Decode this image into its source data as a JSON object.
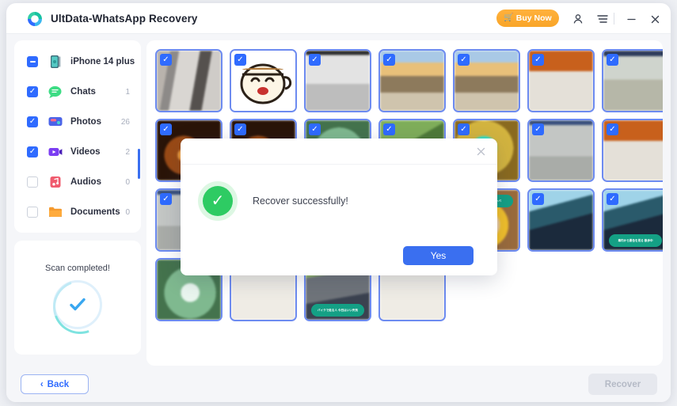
{
  "window": {
    "title": "UltData-WhatsApp Recovery",
    "logo_icon": "tenorshare-swirl-logo",
    "buy_now": {
      "label": "Buy Now",
      "icon": "cart-icon",
      "color": "#f9a528"
    },
    "account_icon": "person-icon",
    "menu_icon": "hamburger-menu-icon",
    "minimize_icon": "minimize-icon",
    "close_icon": "close-icon"
  },
  "sidebar": {
    "items": [
      {
        "label": "iPhone 14 plus",
        "count": "",
        "checkbox": "indeterminate",
        "icon": "phone-icon"
      },
      {
        "label": "Chats",
        "count": "1",
        "checkbox": "checked",
        "icon": "chat-bubble-icon"
      },
      {
        "label": "Photos",
        "count": "26",
        "checkbox": "checked",
        "icon": "photo-icon"
      },
      {
        "label": "Videos",
        "count": "2",
        "checkbox": "checked",
        "icon": "video-icon"
      },
      {
        "label": "Audios",
        "count": "0",
        "checkbox": "unchecked",
        "icon": "audio-note-icon"
      },
      {
        "label": "Documents",
        "count": "0",
        "checkbox": "unchecked",
        "icon": "folder-icon"
      }
    ],
    "scan": {
      "status": "Scan completed!",
      "icon": "check-circle-icon"
    }
  },
  "gallery": {
    "thumbnails": [
      {
        "selected": true,
        "kind": "fabric-gray",
        "badge": ""
      },
      {
        "selected": true,
        "kind": "coffee-emoji",
        "badge": ""
      },
      {
        "selected": true,
        "kind": "gray-gradient",
        "badge": ""
      },
      {
        "selected": true,
        "kind": "beach-dawn",
        "badge": ""
      },
      {
        "selected": true,
        "kind": "beach-dawn",
        "badge": ""
      },
      {
        "selected": true,
        "kind": "orange-table",
        "badge": ""
      },
      {
        "selected": true,
        "kind": "pale-interior",
        "badge": ""
      },
      {
        "selected": true,
        "kind": "candle-dark",
        "badge": ""
      },
      {
        "selected": true,
        "kind": "candle-dark",
        "badge": ""
      },
      {
        "selected": true,
        "kind": "green-blur",
        "badge": ""
      },
      {
        "selected": true,
        "kind": "green-leaf",
        "badge": ""
      },
      {
        "selected": true,
        "kind": "teal-glow",
        "badge": ""
      },
      {
        "selected": true,
        "kind": "mesh-gray",
        "badge": ""
      },
      {
        "selected": true,
        "kind": "orange-table",
        "badge": ""
      },
      {
        "selected": true,
        "kind": "mesh-gray",
        "badge": ""
      },
      {
        "selected": false,
        "kind": "candle-dark",
        "badge": ""
      },
      {
        "selected": false,
        "kind": "teal-glow",
        "badge": ""
      },
      {
        "selected": false,
        "kind": "street-scene",
        "badge": ""
      },
      {
        "selected": true,
        "kind": "latte-heart",
        "badge": "カフェで休憩中\nルンバ"
      },
      {
        "selected": true,
        "kind": "dashboard-teal",
        "badge": ""
      },
      {
        "selected": true,
        "kind": "dashboard-teal",
        "badge": "車内から景色を見る\n散歩中"
      },
      {
        "selected": false,
        "kind": "green-blur",
        "badge": ""
      },
      {
        "selected": false,
        "kind": "pale-beige",
        "badge": ""
      },
      {
        "selected": false,
        "kind": "street-scene",
        "badge": "バイクで走る人\n今日はいい天気"
      },
      {
        "selected": false,
        "kind": "pale-beige",
        "badge": ""
      }
    ]
  },
  "footer": {
    "back": {
      "label": "Back",
      "icon": "chevron-left-icon"
    },
    "recover": {
      "label": "Recover",
      "disabled": true
    }
  },
  "modal": {
    "message": "Recover successfully!",
    "confirm_label": "Yes",
    "close_icon": "close-icon",
    "status_icon": "success-check-icon",
    "accent_color": "#3a6ff0",
    "success_color": "#2ecb63"
  }
}
